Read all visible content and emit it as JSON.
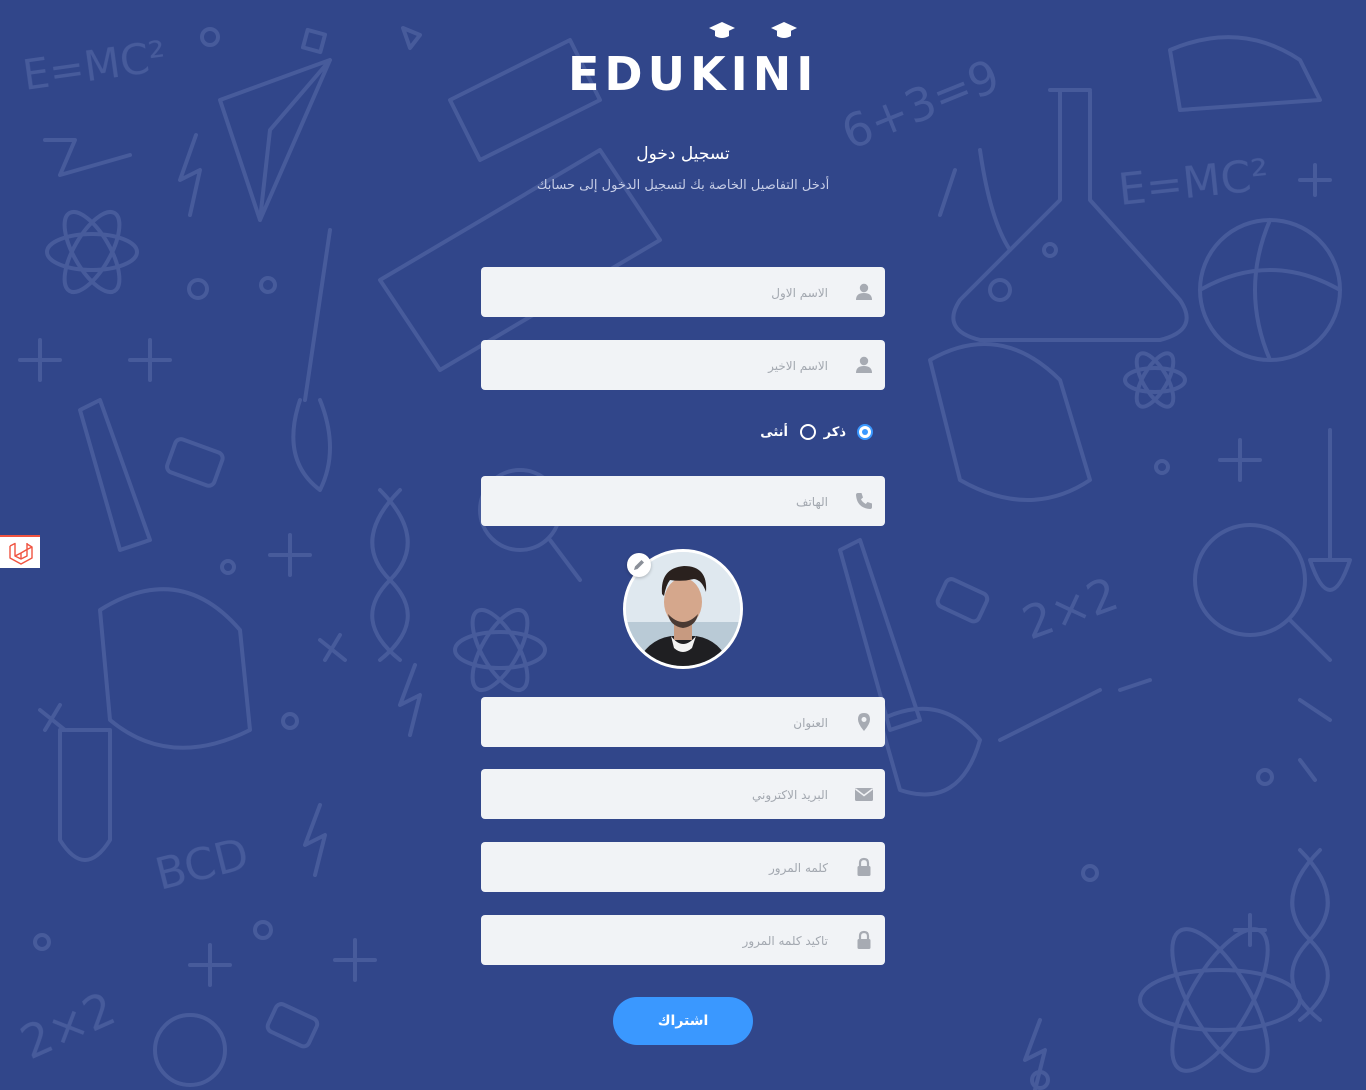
{
  "brand": {
    "logo_text": "EDUKINI"
  },
  "header": {
    "title": "تسجيل دخول",
    "subtitle": "أدخل التفاصيل الخاصة بك لتسجيل الدخول إلى حسابك"
  },
  "form": {
    "first_name": {
      "placeholder": "الاسم الاول",
      "icon": "user-icon"
    },
    "last_name": {
      "placeholder": "الاسم الاخير",
      "icon": "user-icon"
    },
    "gender": {
      "options": [
        {
          "label": "ذكر",
          "selected": true
        },
        {
          "label": "أنثى",
          "selected": false
        }
      ]
    },
    "phone": {
      "placeholder": "الهاتف",
      "icon": "phone-icon"
    },
    "address": {
      "placeholder": "العنوان",
      "icon": "map-pin-icon"
    },
    "email": {
      "placeholder": "البريد الاكتروني",
      "icon": "envelope-icon"
    },
    "password": {
      "placeholder": "كلمه المرور",
      "icon": "lock-icon"
    },
    "confirm_password": {
      "placeholder": "تاكيد كلمه المرور",
      "icon": "lock-icon"
    },
    "submit_label": "اشتراك"
  },
  "colors": {
    "background": "#31468a",
    "accent": "#3a98ff",
    "field_bg": "#f1f3f6"
  }
}
